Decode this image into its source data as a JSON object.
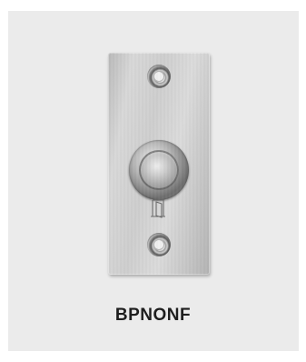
{
  "product": {
    "model": "BPNONF",
    "description_icons": [
      "door-icon"
    ]
  },
  "colors": {
    "background": "#ffffff",
    "card": "#ebebeb",
    "label": "#1e1e1e"
  }
}
